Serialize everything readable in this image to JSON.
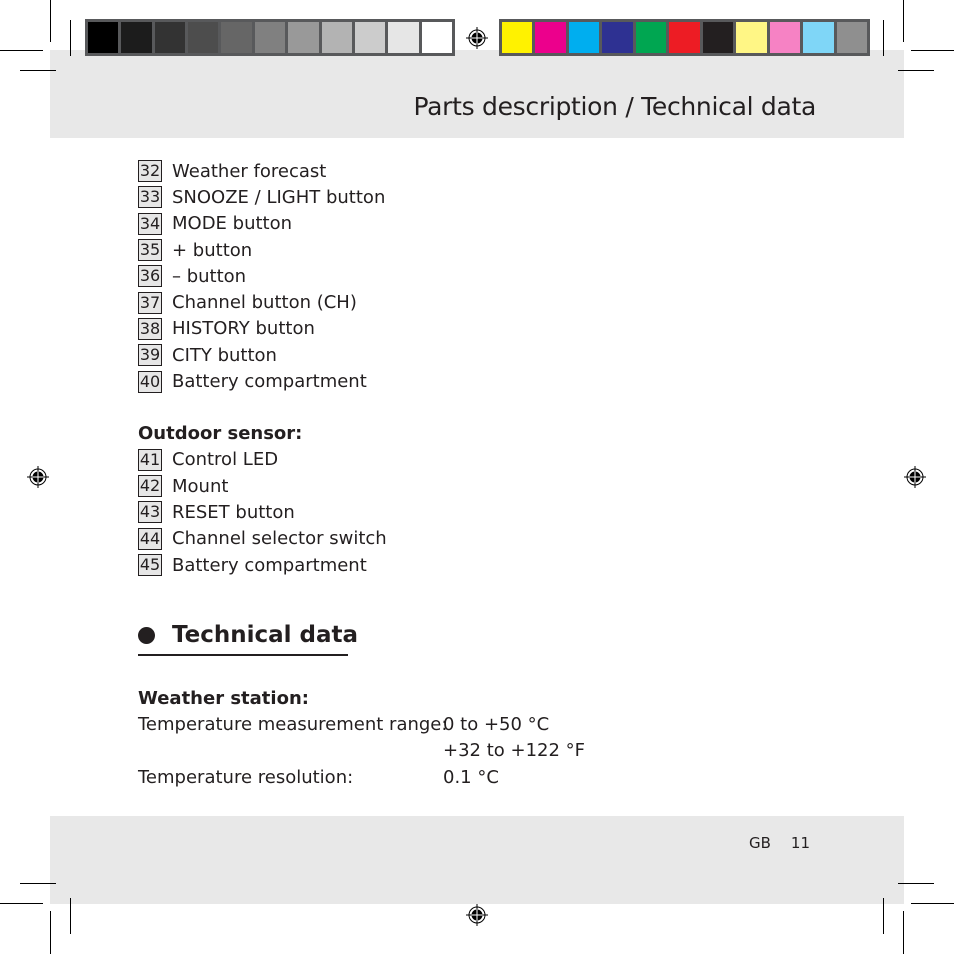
{
  "header": {
    "title": "Parts description / Technical data"
  },
  "color_bar": {
    "grays": [
      "#000000",
      "#1c1c1c",
      "#333333",
      "#4d4d4d",
      "#666666",
      "#808080",
      "#999999",
      "#b3b3b3",
      "#cccccc",
      "#e6e6e6",
      "#ffffff"
    ],
    "colors": [
      "#fff200",
      "#ec008c",
      "#00aeef",
      "#2e3192",
      "#00a651",
      "#ed1c24",
      "#231f20",
      "#fff685",
      "#f682c4",
      "#7fd6f7",
      "#8f8f8f"
    ]
  },
  "parts": [
    {
      "num": "32",
      "label": "Weather forecast"
    },
    {
      "num": "33",
      "label": "SNOOZE / LIGHT button"
    },
    {
      "num": "34",
      "label": "MODE button"
    },
    {
      "num": "35",
      "label": "+ button"
    },
    {
      "num": "36",
      "label": "– button"
    },
    {
      "num": "37",
      "label": "Channel button (CH)"
    },
    {
      "num": "38",
      "label": "HISTORY button"
    },
    {
      "num": "39",
      "label": "CITY button"
    },
    {
      "num": "40",
      "label": "Battery compartment"
    }
  ],
  "outdoor_sensor": {
    "heading": "Outdoor sensor:",
    "parts": [
      {
        "num": "41",
        "label": "Control LED"
      },
      {
        "num": "42",
        "label": "Mount"
      },
      {
        "num": "43",
        "label": "RESET button"
      },
      {
        "num": "44",
        "label": "Channel selector switch"
      },
      {
        "num": "45",
        "label": "Battery compartment"
      }
    ]
  },
  "technical_data": {
    "title": "Technical data",
    "weather_station": {
      "heading": "Weather station:",
      "rows": [
        {
          "label": "Temperature measurement range:",
          "value": "0 to +50 °C"
        },
        {
          "label": "",
          "value": "+32 to +122 °F"
        },
        {
          "label": "Temperature resolution:",
          "value": "0.1 °C"
        }
      ]
    }
  },
  "footer": {
    "lang": "GB",
    "page": "11"
  }
}
